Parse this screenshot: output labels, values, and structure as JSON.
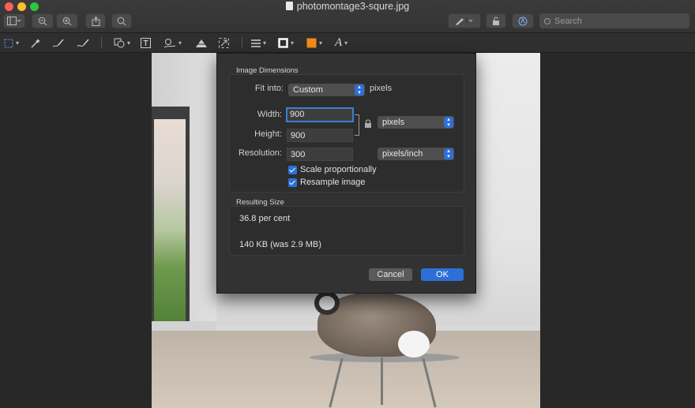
{
  "window": {
    "title": "photomontage3-squre.jpg",
    "search_placeholder": "Search"
  },
  "dialog": {
    "section_image_dimensions": "Image Dimensions",
    "fit_into_label": "Fit into:",
    "fit_into_value": "Custom",
    "fit_into_unit": "pixels",
    "width_label": "Width:",
    "width_value": "900",
    "height_label": "Height:",
    "height_value": "900",
    "size_unit": "pixels",
    "resolution_label": "Resolution:",
    "resolution_value": "300",
    "resolution_unit": "pixels/inch",
    "scale_proportionally_label": "Scale proportionally",
    "scale_proportionally_checked": true,
    "resample_label": "Resample image",
    "resample_checked": true,
    "section_resulting_size": "Resulting Size",
    "result_percent": "36.8 per cent",
    "result_filesize": "140 KB (was 2.9 MB)",
    "cancel_label": "Cancel",
    "ok_label": "OK"
  },
  "colors": {
    "accent": "#2d6fd6",
    "swatch_fill": "#f28c1c",
    "swatch_border": "#ffffff"
  }
}
